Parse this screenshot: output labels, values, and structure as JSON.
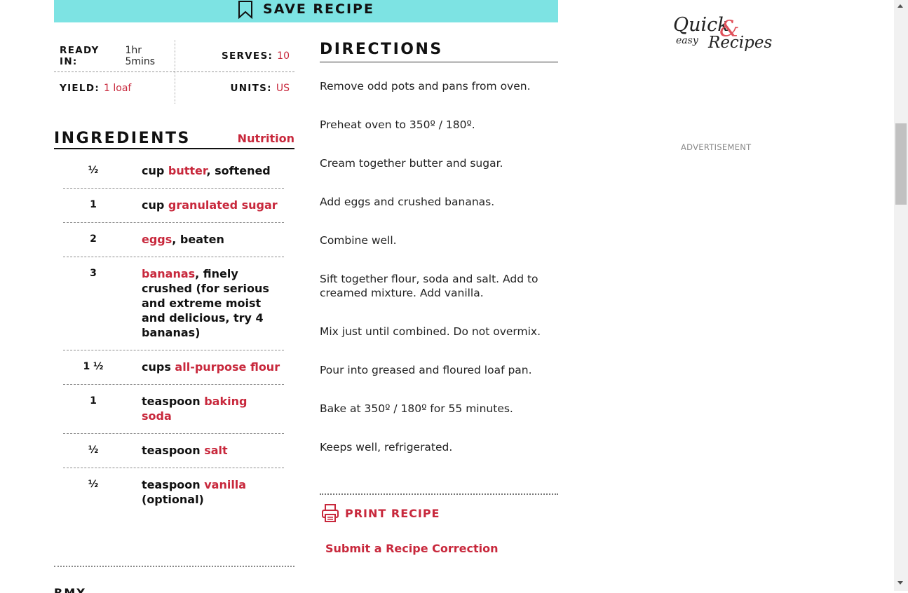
{
  "save_button": {
    "label": "SAVE RECIPE"
  },
  "info": {
    "ready_in_label": "READY IN:",
    "ready_in_value": "1hr 5mins",
    "serves_label": "SERVES:",
    "serves_value": "10",
    "yield_label": "YIELD:",
    "yield_value": "1 loaf",
    "units_label": "UNITS:",
    "units_value": "US"
  },
  "ingredients": {
    "heading": "INGREDIENTS",
    "nutrition_link": "Nutrition",
    "items": [
      {
        "qty": "½",
        "unit": "cup ",
        "name": "butter",
        "note": ", softened"
      },
      {
        "qty": "1",
        "unit": "cup ",
        "name": "granulated sugar",
        "note": ""
      },
      {
        "qty": "2",
        "unit": "",
        "name": "eggs",
        "note": ", beaten"
      },
      {
        "qty": "3",
        "unit": "",
        "name": "bananas",
        "note": ", finely crushed (for serious and extreme moist and delicious, try 4 bananas)"
      },
      {
        "qty": "1 ½",
        "unit": "cups ",
        "name": "all-purpose flour",
        "note": ""
      },
      {
        "qty": "1",
        "unit": "teaspoon ",
        "name": "baking soda",
        "note": ""
      },
      {
        "qty": "½",
        "unit": "teaspoon ",
        "name": "salt",
        "note": ""
      },
      {
        "qty": "½",
        "unit": "teaspoon ",
        "name": "vanilla",
        "note": " (optional)"
      }
    ]
  },
  "directions": {
    "heading": "DIRECTIONS",
    "steps": [
      "Remove odd pots and pans from oven.",
      "Preheat oven to 350º / 180º.",
      "Cream together butter and sugar.",
      "Add eggs and crushed bananas.",
      "Combine well.",
      "Sift together flour, soda and salt. Add to creamed mixture. Add vanilla.",
      "Mix just until combined. Do not overmix.",
      "Pour into greased and floured loaf pan.",
      "Bake at 350º / 180º for 55 minutes.",
      "Keeps well, refrigerated."
    ],
    "print_label": "PRINT RECIPE",
    "correction_link": "Submit a Recipe Correction"
  },
  "sidebar": {
    "logo_quick": "Quick",
    "logo_amp": "&",
    "logo_easy": "easy",
    "logo_recipes": "Recipes",
    "advertisement_label": "ADVERTISEMENT"
  },
  "cut_off_heading": "RMY ... ",
  "colors": {
    "accent_red": "#c8283c",
    "save_bar": "#7de3e3"
  },
  "icons": {
    "save": "bookmark-icon",
    "print": "printer-icon"
  }
}
